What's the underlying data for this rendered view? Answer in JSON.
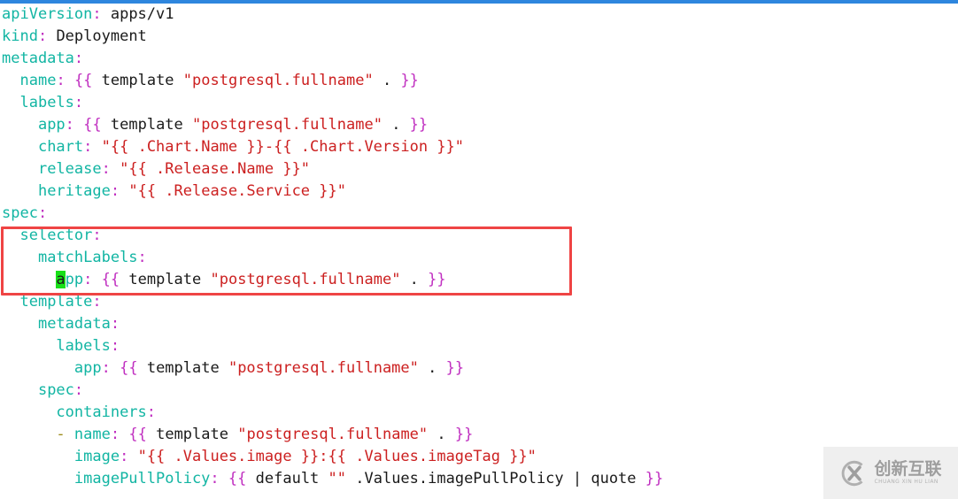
{
  "window": {
    "top_bar_color": "#2e86de",
    "background_color": "#ffffff"
  },
  "editor": {
    "language": "yaml",
    "font_size_px": 17,
    "line_height_px": 25,
    "cursor_char": "a",
    "cursor_line_index": 12,
    "colors": {
      "key": "#12b5a3",
      "punctuation": "#c02fc0",
      "text": "#1a1a1a",
      "string": "#cc2020",
      "dash": "#9c8a1a",
      "cursor_background": "#18e018",
      "highlight_box": "#ef4444"
    },
    "lines": [
      {
        "indent": 0,
        "tokens": [
          {
            "t": "k",
            "v": "apiVersion"
          },
          {
            "t": "c",
            "v": ":"
          },
          {
            "t": "b",
            "v": " apps/v1"
          }
        ]
      },
      {
        "indent": 0,
        "tokens": [
          {
            "t": "k",
            "v": "kind"
          },
          {
            "t": "c",
            "v": ":"
          },
          {
            "t": "b",
            "v": " Deployment"
          }
        ]
      },
      {
        "indent": 0,
        "tokens": [
          {
            "t": "k",
            "v": "metadata"
          },
          {
            "t": "c",
            "v": ":"
          }
        ]
      },
      {
        "indent": 2,
        "tokens": [
          {
            "t": "k",
            "v": "name"
          },
          {
            "t": "c",
            "v": ":"
          },
          {
            "t": "b",
            "v": " "
          },
          {
            "t": "c",
            "v": "{{"
          },
          {
            "t": "b",
            "v": " template "
          },
          {
            "t": "s",
            "v": "\"postgresql.fullname\""
          },
          {
            "t": "b",
            "v": " . "
          },
          {
            "t": "c",
            "v": "}}"
          }
        ]
      },
      {
        "indent": 2,
        "tokens": [
          {
            "t": "k",
            "v": "labels"
          },
          {
            "t": "c",
            "v": ":"
          }
        ]
      },
      {
        "indent": 4,
        "tokens": [
          {
            "t": "k",
            "v": "app"
          },
          {
            "t": "c",
            "v": ":"
          },
          {
            "t": "b",
            "v": " "
          },
          {
            "t": "c",
            "v": "{{"
          },
          {
            "t": "b",
            "v": " template "
          },
          {
            "t": "s",
            "v": "\"postgresql.fullname\""
          },
          {
            "t": "b",
            "v": " . "
          },
          {
            "t": "c",
            "v": "}}"
          }
        ]
      },
      {
        "indent": 4,
        "tokens": [
          {
            "t": "k",
            "v": "chart"
          },
          {
            "t": "c",
            "v": ":"
          },
          {
            "t": "b",
            "v": " "
          },
          {
            "t": "s",
            "v": "\"{{ .Chart.Name }}-{{ .Chart.Version }}\""
          }
        ]
      },
      {
        "indent": 4,
        "tokens": [
          {
            "t": "k",
            "v": "release"
          },
          {
            "t": "c",
            "v": ":"
          },
          {
            "t": "b",
            "v": " "
          },
          {
            "t": "s",
            "v": "\"{{ .Release.Name }}\""
          }
        ]
      },
      {
        "indent": 4,
        "tokens": [
          {
            "t": "k",
            "v": "heritage"
          },
          {
            "t": "c",
            "v": ":"
          },
          {
            "t": "b",
            "v": " "
          },
          {
            "t": "s",
            "v": "\"{{ .Release.Service }}\""
          }
        ]
      },
      {
        "indent": 0,
        "tokens": [
          {
            "t": "k",
            "v": "spec"
          },
          {
            "t": "c",
            "v": ":"
          }
        ]
      },
      {
        "indent": 2,
        "tokens": [
          {
            "t": "k",
            "v": "selector"
          },
          {
            "t": "c",
            "v": ":"
          }
        ]
      },
      {
        "indent": 4,
        "tokens": [
          {
            "t": "k",
            "v": "matchLabels"
          },
          {
            "t": "c",
            "v": ":"
          }
        ]
      },
      {
        "indent": 6,
        "tokens": [
          {
            "t": "cursor",
            "v": "a"
          },
          {
            "t": "k",
            "v": "pp"
          },
          {
            "t": "c",
            "v": ":"
          },
          {
            "t": "b",
            "v": " "
          },
          {
            "t": "c",
            "v": "{{"
          },
          {
            "t": "b",
            "v": " template "
          },
          {
            "t": "s",
            "v": "\"postgresql.fullname\""
          },
          {
            "t": "b",
            "v": " . "
          },
          {
            "t": "c",
            "v": "}}"
          }
        ]
      },
      {
        "indent": 2,
        "tokens": [
          {
            "t": "k",
            "v": "template"
          },
          {
            "t": "c",
            "v": ":"
          }
        ]
      },
      {
        "indent": 4,
        "tokens": [
          {
            "t": "k",
            "v": "metadata"
          },
          {
            "t": "c",
            "v": ":"
          }
        ]
      },
      {
        "indent": 6,
        "tokens": [
          {
            "t": "k",
            "v": "labels"
          },
          {
            "t": "c",
            "v": ":"
          }
        ]
      },
      {
        "indent": 8,
        "tokens": [
          {
            "t": "k",
            "v": "app"
          },
          {
            "t": "c",
            "v": ":"
          },
          {
            "t": "b",
            "v": " "
          },
          {
            "t": "c",
            "v": "{{"
          },
          {
            "t": "b",
            "v": " template "
          },
          {
            "t": "s",
            "v": "\"postgresql.fullname\""
          },
          {
            "t": "b",
            "v": " . "
          },
          {
            "t": "c",
            "v": "}}"
          }
        ]
      },
      {
        "indent": 4,
        "tokens": [
          {
            "t": "k",
            "v": "spec"
          },
          {
            "t": "c",
            "v": ":"
          }
        ]
      },
      {
        "indent": 6,
        "tokens": [
          {
            "t": "k",
            "v": "containers"
          },
          {
            "t": "c",
            "v": ":"
          }
        ]
      },
      {
        "indent": 6,
        "tokens": [
          {
            "t": "d",
            "v": "-"
          },
          {
            "t": "b",
            "v": " "
          },
          {
            "t": "k",
            "v": "name"
          },
          {
            "t": "c",
            "v": ":"
          },
          {
            "t": "b",
            "v": " "
          },
          {
            "t": "c",
            "v": "{{"
          },
          {
            "t": "b",
            "v": " template "
          },
          {
            "t": "s",
            "v": "\"postgresql.fullname\""
          },
          {
            "t": "b",
            "v": " . "
          },
          {
            "t": "c",
            "v": "}}"
          }
        ]
      },
      {
        "indent": 8,
        "tokens": [
          {
            "t": "k",
            "v": "image"
          },
          {
            "t": "c",
            "v": ":"
          },
          {
            "t": "b",
            "v": " "
          },
          {
            "t": "s",
            "v": "\"{{ .Values.image }}:{{ .Values.imageTag }}\""
          }
        ]
      },
      {
        "indent": 8,
        "tokens": [
          {
            "t": "k",
            "v": "imagePullPolicy"
          },
          {
            "t": "c",
            "v": ":"
          },
          {
            "t": "b",
            "v": " "
          },
          {
            "t": "c",
            "v": "{{"
          },
          {
            "t": "b",
            "v": " default "
          },
          {
            "t": "s",
            "v": "\"\""
          },
          {
            "t": "b",
            "v": " .Values.imagePullPolicy | quote "
          },
          {
            "t": "c",
            "v": "}}"
          }
        ]
      }
    ]
  },
  "annotation": {
    "type": "rectangle",
    "color": "#ef4444",
    "covers_lines": [
      "selector:",
      "matchLabels:",
      "app: {{ template \"postgresql.fullname\" . }}"
    ]
  },
  "watermark": {
    "logo_glyph": "X",
    "chinese_text": "创新互联",
    "pinyin_text": "CHUANG XIN HU LIAN",
    "background_color": "#efefef",
    "text_color": "#9e9e9e"
  }
}
